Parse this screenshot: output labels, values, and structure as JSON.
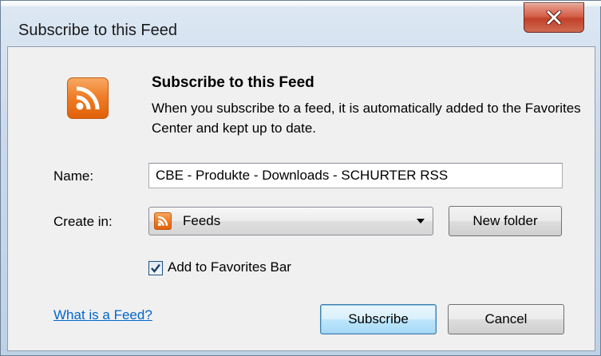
{
  "window": {
    "title": "Subscribe to this Feed"
  },
  "header": {
    "heading": "Subscribe to this Feed",
    "description": "When you subscribe to a feed, it is automatically added to the Favorites Center and kept up to date."
  },
  "form": {
    "name_label": "Name:",
    "name_value": "CBE - Produkte - Downloads - SCHURTER RSS",
    "create_in_label": "Create in:",
    "create_in_value": "Feeds",
    "new_folder_label": "New folder",
    "add_to_favorites_label": "Add to Favorites Bar",
    "add_to_favorites_checked": true
  },
  "footer": {
    "help_link": "What is a Feed?",
    "subscribe_label": "Subscribe",
    "cancel_label": "Cancel"
  },
  "icons": {
    "feed": "rss-feed-icon",
    "close": "close-icon",
    "dropdown": "chevron-down-icon",
    "check": "checkmark-icon"
  },
  "colors": {
    "feed_orange": "#ee7b22",
    "link_blue": "#0066cc",
    "close_red": "#c2412a",
    "default_button_blue": "#3c7fb1"
  }
}
